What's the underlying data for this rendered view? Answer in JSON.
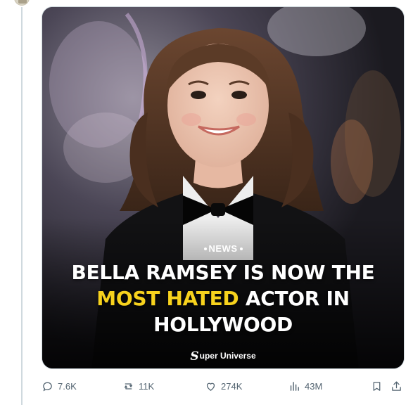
{
  "post": {
    "image": {
      "kicker": "NEWS",
      "headline_line1": "BELLA RAMSEY IS NOW THE",
      "headline_highlight": "MOST HATED",
      "headline_line2_rest": "ACTOR IN",
      "headline_line3": "HOLLYWOOD",
      "brand_mark": "S",
      "brand_text": "uper Universe",
      "highlight_color": "#f7d21d"
    },
    "actions": {
      "replies": {
        "icon": "reply-icon",
        "count": "7.6K"
      },
      "reposts": {
        "icon": "repost-icon",
        "count": "11K"
      },
      "likes": {
        "icon": "heart-icon",
        "count": "274K"
      },
      "views": {
        "icon": "views-chart-icon",
        "count": "43M"
      },
      "bookmark": {
        "icon": "bookmark-icon"
      },
      "share": {
        "icon": "share-icon"
      }
    }
  }
}
